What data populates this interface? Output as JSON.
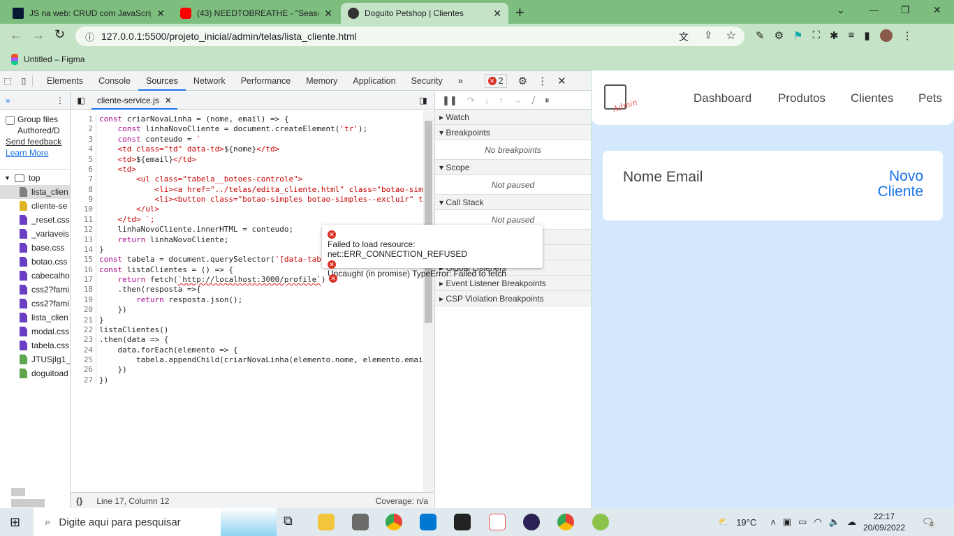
{
  "browser": {
    "tabs": [
      {
        "title": "JS na web: CRUD com JavaScript",
        "icon": "alura-icon",
        "color": "#051933"
      },
      {
        "title": "(43) NEEDTOBREATHE - \"Seasons",
        "icon": "youtube-icon",
        "color": "#ff0000"
      },
      {
        "title": "Doguito Petshop | Clientes",
        "icon": "globe-icon",
        "color": "#333333"
      }
    ],
    "url": "127.0.0.1:5500/projeto_inicial/admin/telas/lista_cliente.html",
    "bookmark": "Untitled – Figma"
  },
  "devtools": {
    "tabs": [
      "Elements",
      "Console",
      "Sources",
      "Network",
      "Performance",
      "Memory",
      "Application",
      "Security"
    ],
    "active_tab": "Sources",
    "more": "»",
    "error_count": "2",
    "navigator": {
      "group_files": "Group files",
      "authored": "Authored/D",
      "send_feedback": "Send feedback",
      "learn_more": "Learn More",
      "top": "top",
      "files": [
        {
          "name": "lista_clien",
          "color": "#808080"
        },
        {
          "name": "cliente-se",
          "color": "#e0b624"
        },
        {
          "name": "_reset.css",
          "color": "#6a3fc4"
        },
        {
          "name": "_variaveis.",
          "color": "#6a3fc4"
        },
        {
          "name": "base.css",
          "color": "#6a3fc4"
        },
        {
          "name": "botao.css",
          "color": "#6a3fc4"
        },
        {
          "name": "cabecalho",
          "color": "#6a3fc4"
        },
        {
          "name": "css2?fami",
          "color": "#6a3fc4"
        },
        {
          "name": "css2?fami",
          "color": "#6a3fc4"
        },
        {
          "name": "lista_clien",
          "color": "#6a3fc4"
        },
        {
          "name": "modal.css",
          "color": "#6a3fc4"
        },
        {
          "name": "tabela.css",
          "color": "#6a3fc4"
        },
        {
          "name": "JTUSjIg1_i",
          "color": "#5fa64f"
        },
        {
          "name": "doguitoad",
          "color": "#5fa64f"
        }
      ]
    },
    "editor": {
      "file_tab": "cliente-service.js",
      "lines": [
        [
          [
            "const ",
            "kw"
          ],
          [
            "criarNovaLinha = (nome, email) => {",
            "pl"
          ]
        ],
        [
          [
            "    const ",
            "kw"
          ],
          [
            "linhaNovoCliente = document.createElement(",
            "pl"
          ],
          [
            "'tr'",
            "str"
          ],
          [
            ");",
            "pl"
          ]
        ],
        [
          [
            "    const ",
            "kw"
          ],
          [
            "conteudo = ",
            "pl"
          ],
          [
            "`",
            "str"
          ]
        ],
        [
          [
            "    <td class=\"td\" data-td>",
            "tag"
          ],
          [
            "${nome}",
            "pl"
          ],
          [
            "</td>",
            "tag"
          ]
        ],
        [
          [
            "    <td>",
            "tag"
          ],
          [
            "${email}",
            "pl"
          ],
          [
            "</td>",
            "tag"
          ]
        ],
        [
          [
            "    <td>",
            "tag"
          ]
        ],
        [
          [
            "        <ul class=\"tabela__botoes-controle\">",
            "tag"
          ]
        ],
        [
          [
            "            <li><a href=\"../telas/edita_cliente.html\" class=\"botao-sim",
            "tag"
          ]
        ],
        [
          [
            "            <li><button class=\"botao-simples botao-simples--excluir\" t",
            "tag"
          ]
        ],
        [
          [
            "        </ul>",
            "tag"
          ]
        ],
        [
          [
            "    </td> ",
            "tag"
          ],
          [
            "`;",
            "str"
          ]
        ],
        [
          [
            "    linhaNovoCliente.innerHTML = conteudo;",
            "pl"
          ]
        ],
        [
          [
            "    return ",
            "kw"
          ],
          [
            "linhaNovoCliente;",
            "pl"
          ]
        ],
        [
          [
            "}",
            "pl"
          ]
        ],
        [
          [
            "const ",
            "kw"
          ],
          [
            "tabela = document.querySelector(",
            "pl"
          ],
          [
            "'[data-tab",
            "str"
          ]
        ],
        [
          [
            "const ",
            "kw"
          ],
          [
            "listaClientes = () => {",
            "pl"
          ]
        ],
        [
          [
            "    return ",
            "kw"
          ],
          [
            "fetch(",
            "pl"
          ],
          [
            "`http://localhost:3000/profile`",
            "url"
          ],
          [
            ")",
            "pl"
          ]
        ],
        [
          [
            "    .then(resposta =>{",
            "pl"
          ]
        ],
        [
          [
            "        return ",
            "kw"
          ],
          [
            "resposta.json();",
            "pl"
          ]
        ],
        [
          [
            "    })",
            "pl"
          ]
        ],
        [
          [
            "}",
            "pl"
          ]
        ],
        [
          [
            "listaClientes()",
            "pl"
          ]
        ],
        [
          [
            ".then(data => {",
            "pl"
          ]
        ],
        [
          [
            "    data.forEach(elemento => {",
            "pl"
          ]
        ],
        [
          [
            "        tabela.appendChild(criarNovaLinha(elemento.nome, elemento.emai",
            "pl"
          ]
        ],
        [
          [
            "    })",
            "pl"
          ]
        ],
        [
          [
            "})",
            "pl"
          ]
        ]
      ],
      "status_position": "Line 17, Column 12",
      "coverage": "Coverage: n/a",
      "pretty_print": "{}"
    },
    "tooltip": {
      "error1": "Failed to load resource: net::ERR_CONNECTION_REFUSED",
      "error2": "Uncaught (in promise) TypeError: Failed to fetch"
    },
    "debugger": {
      "watch": "Watch",
      "breakpoints": "Breakpoints",
      "no_breakpoints": "No breakpoints",
      "scope": "Scope",
      "not_paused": "Not paused",
      "call_stack": "Call Stack",
      "global_listeners": "Global Listeners",
      "event_listener": "Event Listener Breakpoints",
      "csp": "CSP Violation Breakpoints"
    }
  },
  "page": {
    "logo_text": "Admin",
    "nav": [
      "Dashboard",
      "Produtos",
      "Clientes",
      "Pets"
    ],
    "table_header": "Nome Email",
    "new_client_1": "Novo",
    "new_client_2": "Cliente",
    "accent": "#1a73e8"
  },
  "taskbar": {
    "search_placeholder": "Digite aqui para pesquisar",
    "weather": "19°C",
    "time": "22:17",
    "date": "20/09/2022",
    "notifications": "4"
  }
}
